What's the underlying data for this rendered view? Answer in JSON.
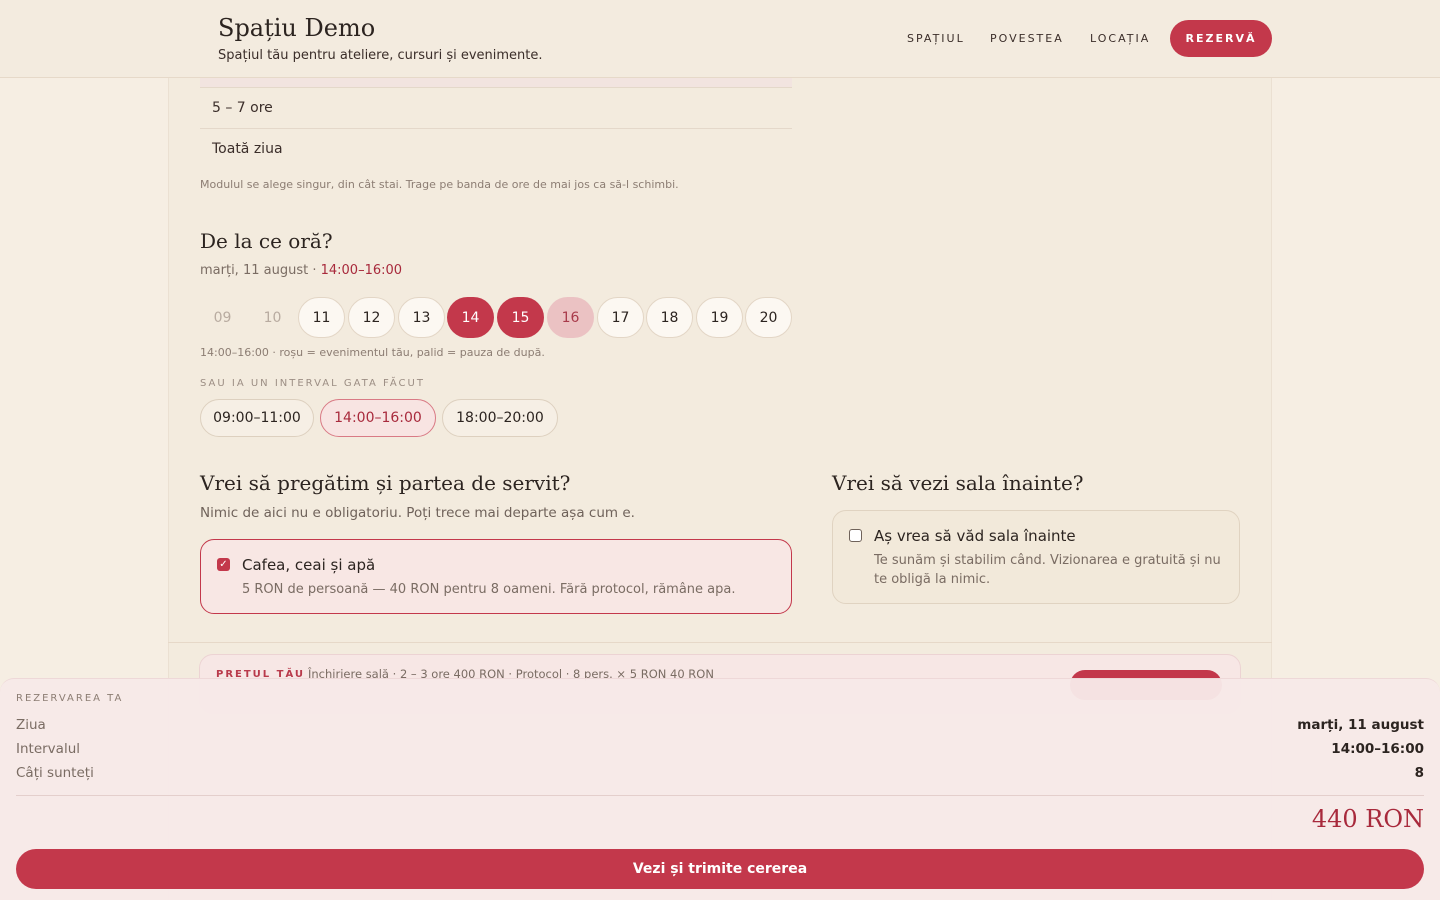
{
  "header": {
    "title": "Spațiu Demo",
    "subtitle": "Spațiul tău pentru ateliere, cursuri și evenimente.",
    "nav": [
      "SPAȚIUL",
      "POVESTEA",
      "LOCAȚIA"
    ],
    "cta": "REZERVĂ"
  },
  "duration": {
    "options": [
      "5 – 7 ore",
      "Toată ziua"
    ],
    "hint": "Modulul se alege singur, din cât stai. Trage pe banda de ore de mai jos ca să-l schimbi."
  },
  "time": {
    "heading": "De la ce oră?",
    "date": "marți, 11 august",
    "range": "14:00–16:00",
    "hours": [
      {
        "label": "09",
        "state": "off"
      },
      {
        "label": "10",
        "state": "off"
      },
      {
        "label": "11",
        "state": "free"
      },
      {
        "label": "12",
        "state": "free"
      },
      {
        "label": "13",
        "state": "free"
      },
      {
        "label": "14",
        "state": "selected"
      },
      {
        "label": "15",
        "state": "selected"
      },
      {
        "label": "16",
        "state": "pause"
      },
      {
        "label": "17",
        "state": "free"
      },
      {
        "label": "18",
        "state": "free"
      },
      {
        "label": "19",
        "state": "free"
      },
      {
        "label": "20",
        "state": "free"
      }
    ],
    "legend": "14:00–16:00 · roșu = evenimentul tău, palid = pauza de după.",
    "preset_title": "SAU IA UN INTERVAL GATA FĂCUT",
    "presets": [
      "09:00–11:00",
      "14:00–16:00",
      "18:00–20:00"
    ],
    "active_preset": "14:00–16:00"
  },
  "catering": {
    "heading": "Vrei să pregătim și partea de servit?",
    "sub": "Nimic de aici nu e obligatoriu. Poți trece mai departe așa cum e.",
    "option_title": "Cafea, ceai și apă",
    "option_desc": "5 RON de persoană — 40 RON pentru 8 oameni. Fără protocol, rămâne apa.",
    "checked": true
  },
  "visit": {
    "heading": "Vrei să vezi sala înainte?",
    "option_title": "Aș vrea să văd sala înainte",
    "option_desc": "Te sunăm și stabilim când. Vizionarea e gratuită și nu te obligă la nimic.",
    "checked": false
  },
  "price_strip": {
    "label": "PREȚUL TĂU",
    "detail": "Închiriere sală · 2 – 3 ore 400 RON · Protocol · 8 pers. × 5 RON 40 RON"
  },
  "summary": {
    "overline": "REZERVAREA TA",
    "rows": [
      {
        "label": "Ziua",
        "value": "marți, 11 august"
      },
      {
        "label": "Intervalul",
        "value": "14:00–16:00"
      },
      {
        "label": "Câți sunteți",
        "value": "8"
      }
    ],
    "total": "440 RON",
    "submit": "Vezi și trimite cererea"
  },
  "colors": {
    "accent": "#c3384b",
    "pause": "#ebc2c3",
    "background": "#f6eee3"
  }
}
